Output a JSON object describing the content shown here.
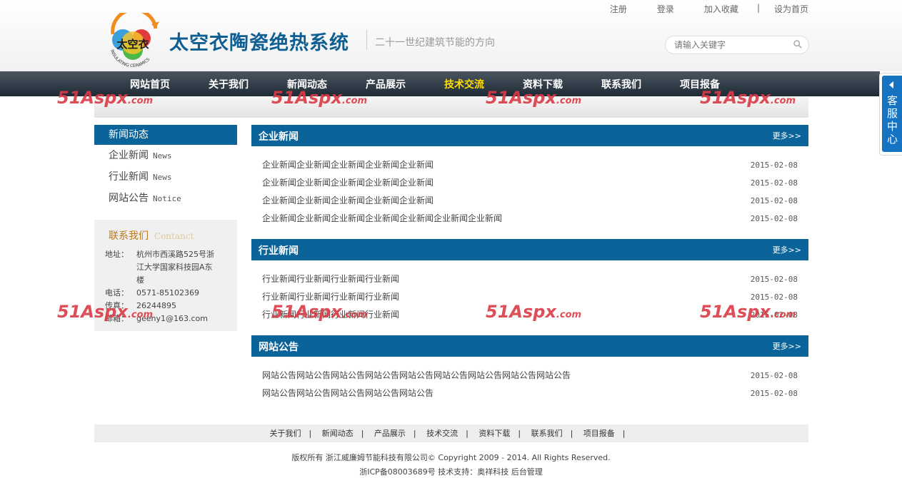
{
  "header": {
    "top_links": [
      "注册",
      "登录",
      "加入收藏",
      "|",
      "设为首页"
    ],
    "logo_text": "太空衣",
    "logo_ring_text": "INSULATING CERAMICS",
    "brand": "太空衣陶瓷绝热系统",
    "slogan": "二十一世纪建筑节能的方向",
    "search_placeholder": "请输入关键字"
  },
  "nav": {
    "items": [
      "网站首页",
      "关于我们",
      "新闻动态",
      "产品展示",
      "技术交流",
      "资料下载",
      "联系我们",
      "项目报备"
    ],
    "active_index": 4,
    "active_color": "#ffde00"
  },
  "watermark": {
    "text": "51Aspx",
    "suffix": ".com",
    "color": "#d93b46"
  },
  "sidebar": {
    "title": "新闻动态",
    "items": [
      {
        "label": "企业新闻",
        "en": "News"
      },
      {
        "label": "行业新闻",
        "en": "News"
      },
      {
        "label": "网站公告",
        "en": "Notice"
      }
    ]
  },
  "contact": {
    "title": "联系我们",
    "title_en": "Contanct",
    "address_label": "地址：",
    "address_line1": "杭州市西溪路525号浙",
    "address_line2": "江大学国家科技园A东",
    "address_line3": "楼",
    "phone_label": "电话：",
    "phone": "0571-85102369",
    "fax_label": "传真：",
    "fax": "26244895",
    "email_label": "邮箱：",
    "email": "geeny1@163.com"
  },
  "sections": [
    {
      "title": "企业新闻",
      "more": "更多>>",
      "rows": [
        {
          "title": "企业新闻企业新闻企业新闻企业新闻企业新闻",
          "date": "2015-02-08"
        },
        {
          "title": "企业新闻企业新闻企业新闻企业新闻企业新闻",
          "date": "2015-02-08"
        },
        {
          "title": "企业新闻企业新闻企业新闻企业新闻企业新闻",
          "date": "2015-02-08"
        },
        {
          "title": "企业新闻企业新闻企业新闻企业新闻企业新闻企业新闻企业新闻",
          "date": "2015-02-08"
        }
      ]
    },
    {
      "title": "行业新闻",
      "more": "更多>>",
      "rows": [
        {
          "title": "行业新闻行业新闻行业新闻行业新闻",
          "date": "2015-02-08"
        },
        {
          "title": "行业新闻行业新闻行业新闻行业新闻",
          "date": "2015-02-08"
        },
        {
          "title": "行业新闻行业新闻行业新闻行业新闻",
          "date": "2015-02-08"
        }
      ]
    },
    {
      "title": "网站公告",
      "more": "更多>>",
      "rows": [
        {
          "title": "网站公告网站公告网站公告网站公告网站公告网站公告网站公告网站公告网站公告",
          "date": "2015-02-08"
        },
        {
          "title": "网站公告网站公告网站公告网站公告网站公告",
          "date": "2015-02-08"
        }
      ]
    }
  ],
  "footer": {
    "links": [
      "关于我们",
      "新闻动态",
      "产品展示",
      "技术交流",
      "资料下载",
      "联系我们",
      "项目报备"
    ],
    "separator": "|",
    "copyright": "版权所有 浙江威廉姆节能科技有限公司© Copyright 2009 - 2014. All Rights Reserved.",
    "icp": "浙ICP备08003689号",
    "tech_support_label": "技术支持：",
    "tech_support": "奥祥科技",
    "admin": "后台管理"
  },
  "service": {
    "label": "客服中心"
  },
  "colors": {
    "primary": "#0a6399",
    "nav_bg": "#2a3440",
    "contact_title": "#b87a21"
  }
}
